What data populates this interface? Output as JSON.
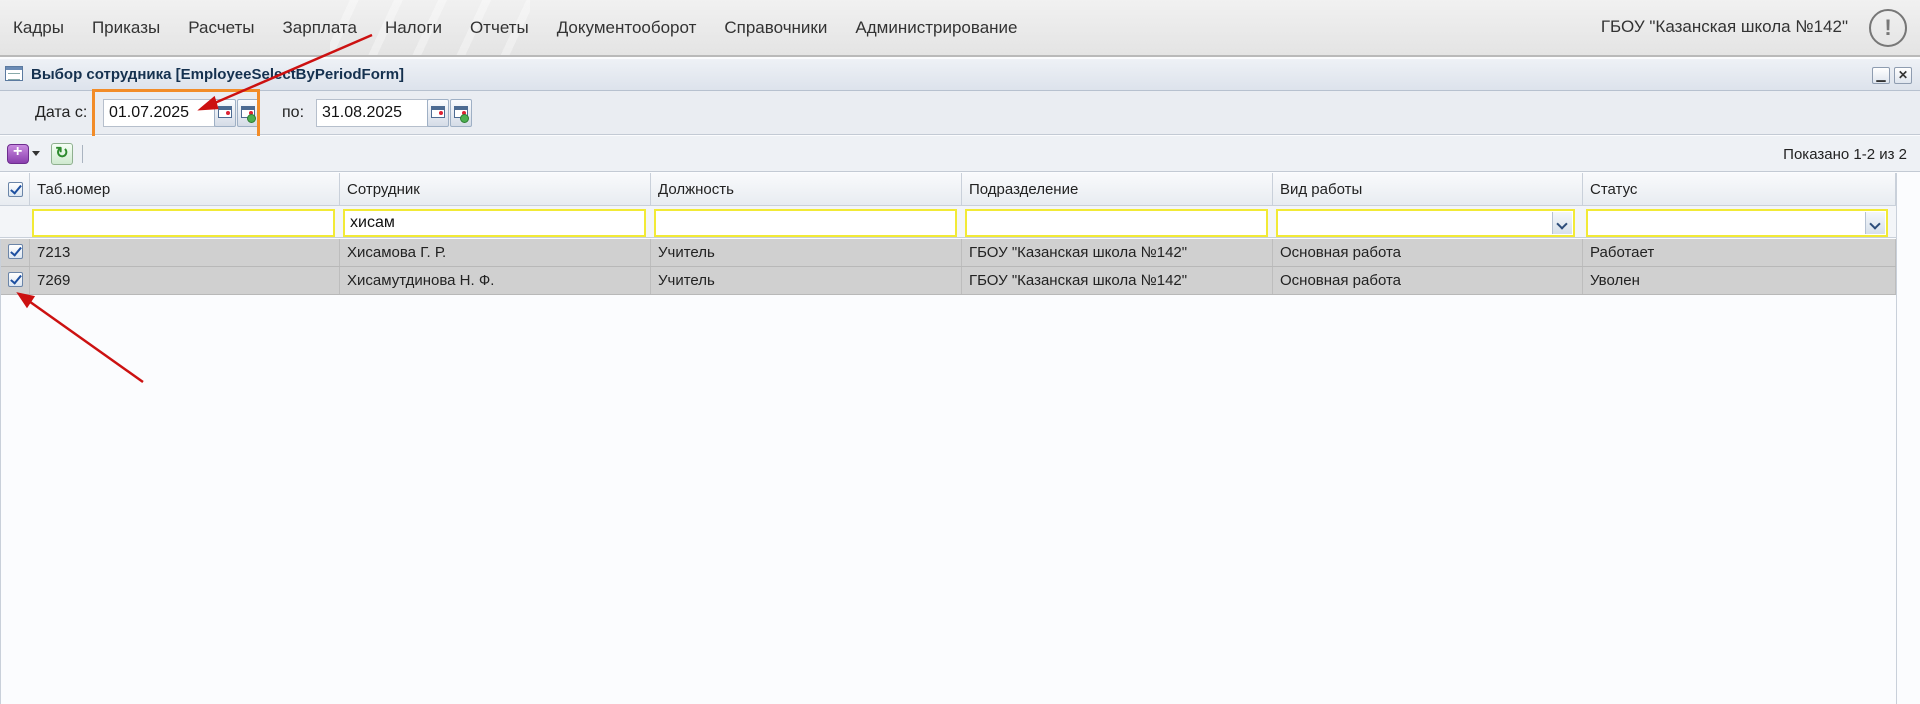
{
  "menu": {
    "items": [
      "Кадры",
      "Приказы",
      "Расчеты",
      "Зарплата",
      "Налоги",
      "Отчеты",
      "Документооборот",
      "Справочники",
      "Администрирование"
    ],
    "organization": "ГБОУ \"Казанская школа №142\"",
    "alert_glyph": "!"
  },
  "window": {
    "title": "Выбор сотрудника [EmployeeSelectByPeriodForm]",
    "minimize_glyph": "▁",
    "close_glyph": "✕"
  },
  "date_filter": {
    "from_label": "Дата с:",
    "from_value": "01.07.2025",
    "to_label": "по:",
    "to_value": "31.08.2025"
  },
  "toolbar": {
    "shown_text": "Показано 1-2 из 2",
    "refresh_glyph": "↻"
  },
  "grid": {
    "columns": [
      "Таб.номер",
      "Сотрудник",
      "Должность",
      "Подразделение",
      "Вид работы",
      "Статус"
    ],
    "filters": [
      "",
      "хисам",
      "",
      "",
      "",
      ""
    ],
    "rows": [
      {
        "checked": true,
        "cells": [
          "7213",
          "Хисамова Г. Р.",
          "Учитель",
          "ГБОУ \"Казанская школа №142\"",
          "Основная работа",
          "Работает"
        ]
      },
      {
        "checked": true,
        "cells": [
          "7269",
          "Хисамутдинова Н. Ф.",
          "Учитель",
          "ГБОУ \"Казанская школа №142\"",
          "Основная работа",
          "Уволен"
        ]
      }
    ]
  },
  "colors": {
    "highlight": "#f28c28",
    "annotation_arrow": "#cc1111",
    "filter_border": "#f2ea36",
    "row_bg": "#d0d0d0"
  }
}
